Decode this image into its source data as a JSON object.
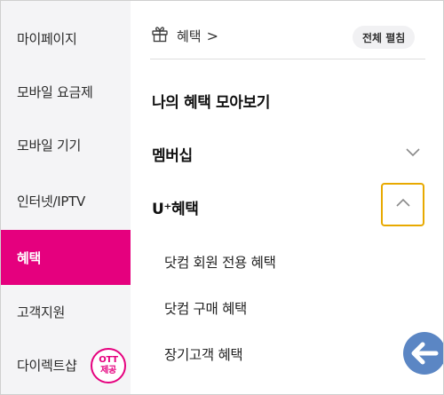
{
  "sidebar": {
    "items": [
      {
        "label": "마이페이지"
      },
      {
        "label": "모바일 요금제"
      },
      {
        "label": "모바일 기기"
      },
      {
        "label": "인터넷/IPTV"
      },
      {
        "label": "혜택",
        "active": true
      },
      {
        "label": "고객지원"
      },
      {
        "label": "다이렉트샵"
      }
    ],
    "ott_badge": {
      "line1": "OTT",
      "line2": "제공"
    }
  },
  "main": {
    "breadcrumb": {
      "icon": "gift-icon",
      "label": "혜택",
      "chevron": ">"
    },
    "expand_all_label": "전체 펼침",
    "menu": [
      {
        "label": "나의 혜택 모아보기"
      },
      {
        "label": "멤버십",
        "state": "collapsed"
      },
      {
        "label": "U⁺혜택",
        "state": "expanded"
      }
    ],
    "submenu": [
      {
        "label": "닷컴 회원 전용 혜택"
      },
      {
        "label": "닷컴 구매 혜택"
      },
      {
        "label": "장기고객 혜택"
      }
    ]
  },
  "colors": {
    "accent": "#e5007e",
    "highlight_box": "#e8a900",
    "annotation_arrow": "#5b86c4",
    "sidebar_bg": "#f4f4f6"
  }
}
